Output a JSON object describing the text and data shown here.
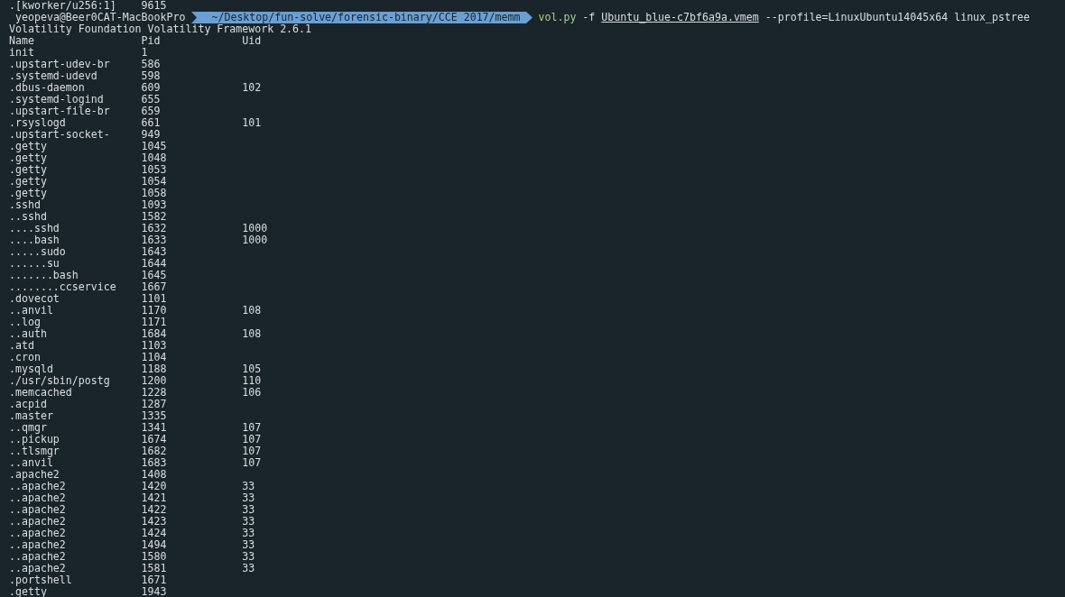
{
  "previous_line": {
    "name": ".[kworker/u256:1]",
    "pid": "9615"
  },
  "prompt": {
    "user_host": "yeopeva@Beer0CAT-MacBookPro",
    "path": "~/Desktop/fun-solve/forensic-binary/CCE 2017/memm",
    "command": "vol.py",
    "args": [
      {
        "text": "-f",
        "kind": "plain"
      },
      {
        "text": "Ubuntu_blue-c7bf6a9a.vmem",
        "kind": "path"
      },
      {
        "text": "--profile=LinuxUbuntu14045x64",
        "kind": "plain"
      },
      {
        "text": "linux_pstree",
        "kind": "plain"
      }
    ]
  },
  "banner": "Volatility Foundation Volatility Framework 2.6.1",
  "columns": [
    "Name",
    "Pid",
    "Uid"
  ],
  "rows": [
    {
      "name": "init",
      "pid": "1"
    },
    {
      "name": ".upstart-udev-br",
      "pid": "586"
    },
    {
      "name": ".systemd-udevd",
      "pid": "598"
    },
    {
      "name": ".dbus-daemon",
      "pid": "609",
      "uid": "102"
    },
    {
      "name": ".systemd-logind",
      "pid": "655"
    },
    {
      "name": ".upstart-file-br",
      "pid": "659"
    },
    {
      "name": ".rsyslogd",
      "pid": "661",
      "uid": "101"
    },
    {
      "name": ".upstart-socket-",
      "pid": "949"
    },
    {
      "name": ".getty",
      "pid": "1045"
    },
    {
      "name": ".getty",
      "pid": "1048"
    },
    {
      "name": ".getty",
      "pid": "1053"
    },
    {
      "name": ".getty",
      "pid": "1054"
    },
    {
      "name": ".getty",
      "pid": "1058"
    },
    {
      "name": ".sshd",
      "pid": "1093"
    },
    {
      "name": "..sshd",
      "pid": "1582"
    },
    {
      "name": "....sshd",
      "pid": "1632",
      "uid": "1000"
    },
    {
      "name": "....bash",
      "pid": "1633",
      "uid": "1000"
    },
    {
      "name": ".....sudo",
      "pid": "1643"
    },
    {
      "name": "......su",
      "pid": "1644"
    },
    {
      "name": ".......bash",
      "pid": "1645"
    },
    {
      "name": "........ccservice",
      "pid": "1667"
    },
    {
      "name": ".dovecot",
      "pid": "1101"
    },
    {
      "name": "..anvil",
      "pid": "1170",
      "uid": "108"
    },
    {
      "name": "..log",
      "pid": "1171"
    },
    {
      "name": "..auth",
      "pid": "1684",
      "uid": "108"
    },
    {
      "name": ".atd",
      "pid": "1103"
    },
    {
      "name": ".cron",
      "pid": "1104"
    },
    {
      "name": ".mysqld",
      "pid": "1188",
      "uid": "105"
    },
    {
      "name": "./usr/sbin/postg",
      "pid": "1200",
      "uid": "110"
    },
    {
      "name": ".memcached",
      "pid": "1228",
      "uid": "106"
    },
    {
      "name": ".acpid",
      "pid": "1287"
    },
    {
      "name": ".master",
      "pid": "1335"
    },
    {
      "name": "..qmgr",
      "pid": "1341",
      "uid": "107"
    },
    {
      "name": "..pickup",
      "pid": "1674",
      "uid": "107"
    },
    {
      "name": "..tlsmgr",
      "pid": "1682",
      "uid": "107"
    },
    {
      "name": "..anvil",
      "pid": "1683",
      "uid": "107"
    },
    {
      "name": ".apache2",
      "pid": "1408"
    },
    {
      "name": "..apache2",
      "pid": "1420",
      "uid": "33"
    },
    {
      "name": "..apache2",
      "pid": "1421",
      "uid": "33"
    },
    {
      "name": "..apache2",
      "pid": "1422",
      "uid": "33"
    },
    {
      "name": "..apache2",
      "pid": "1423",
      "uid": "33"
    },
    {
      "name": "..apache2",
      "pid": "1424",
      "uid": "33"
    },
    {
      "name": "..apache2",
      "pid": "1494",
      "uid": "33"
    },
    {
      "name": "..apache2",
      "pid": "1580",
      "uid": "33"
    },
    {
      "name": "..apache2",
      "pid": "1581",
      "uid": "33"
    },
    {
      "name": ".portshell",
      "pid": "1671"
    },
    {
      "name": ".getty",
      "pid": "1943"
    }
  ]
}
